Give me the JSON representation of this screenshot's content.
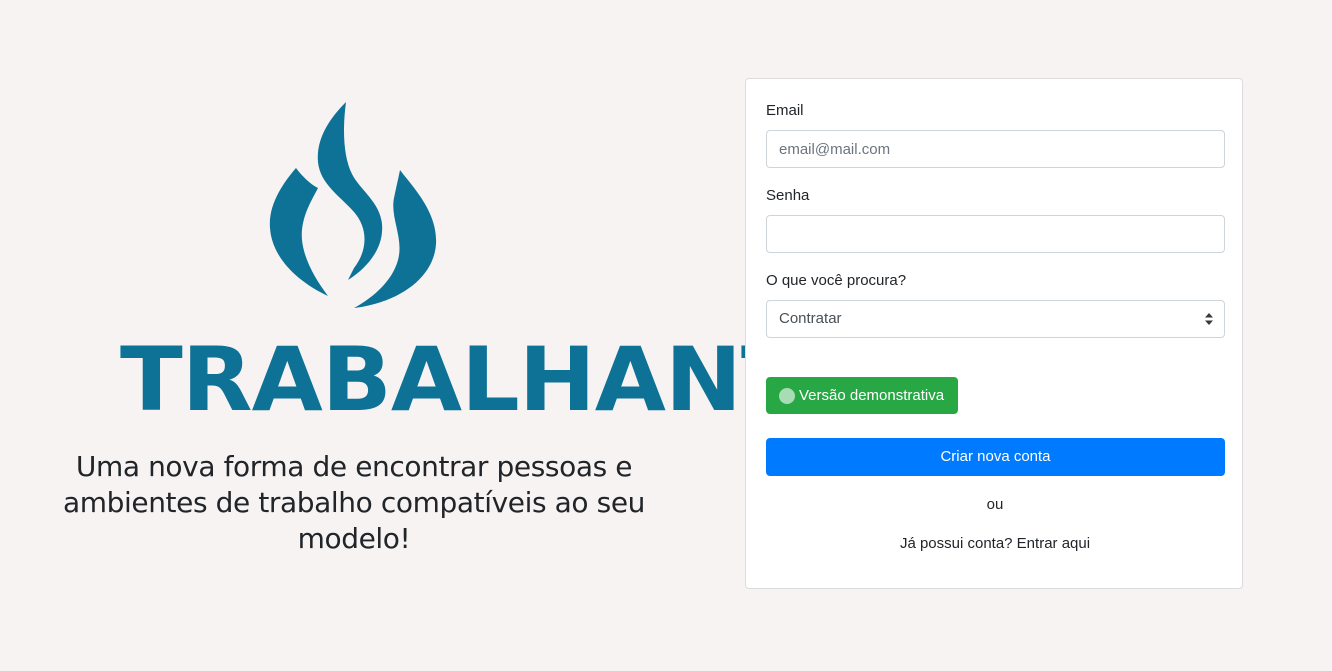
{
  "branding": {
    "name": "TRABALHANTE",
    "tagline": "Uma nova forma de encontrar pessoas e ambientes de trabalho compatíveis ao seu modelo!",
    "logo_icon": "flame-icon",
    "brand_color": "#0e7296"
  },
  "form": {
    "email": {
      "label": "Email",
      "value": "",
      "placeholder": "email@mail.com"
    },
    "password": {
      "label": "Senha",
      "value": "",
      "placeholder": ""
    },
    "looking_for": {
      "label": "O que você procura?",
      "selected": "Contratar"
    },
    "demo_button": {
      "label": "Versão demonstrativa",
      "color": "#28a745"
    },
    "create_button": {
      "label": "Criar nova conta",
      "color": "#007bff"
    },
    "or_text": "ou",
    "login_link": "Já possui conta? Entrar aqui"
  }
}
